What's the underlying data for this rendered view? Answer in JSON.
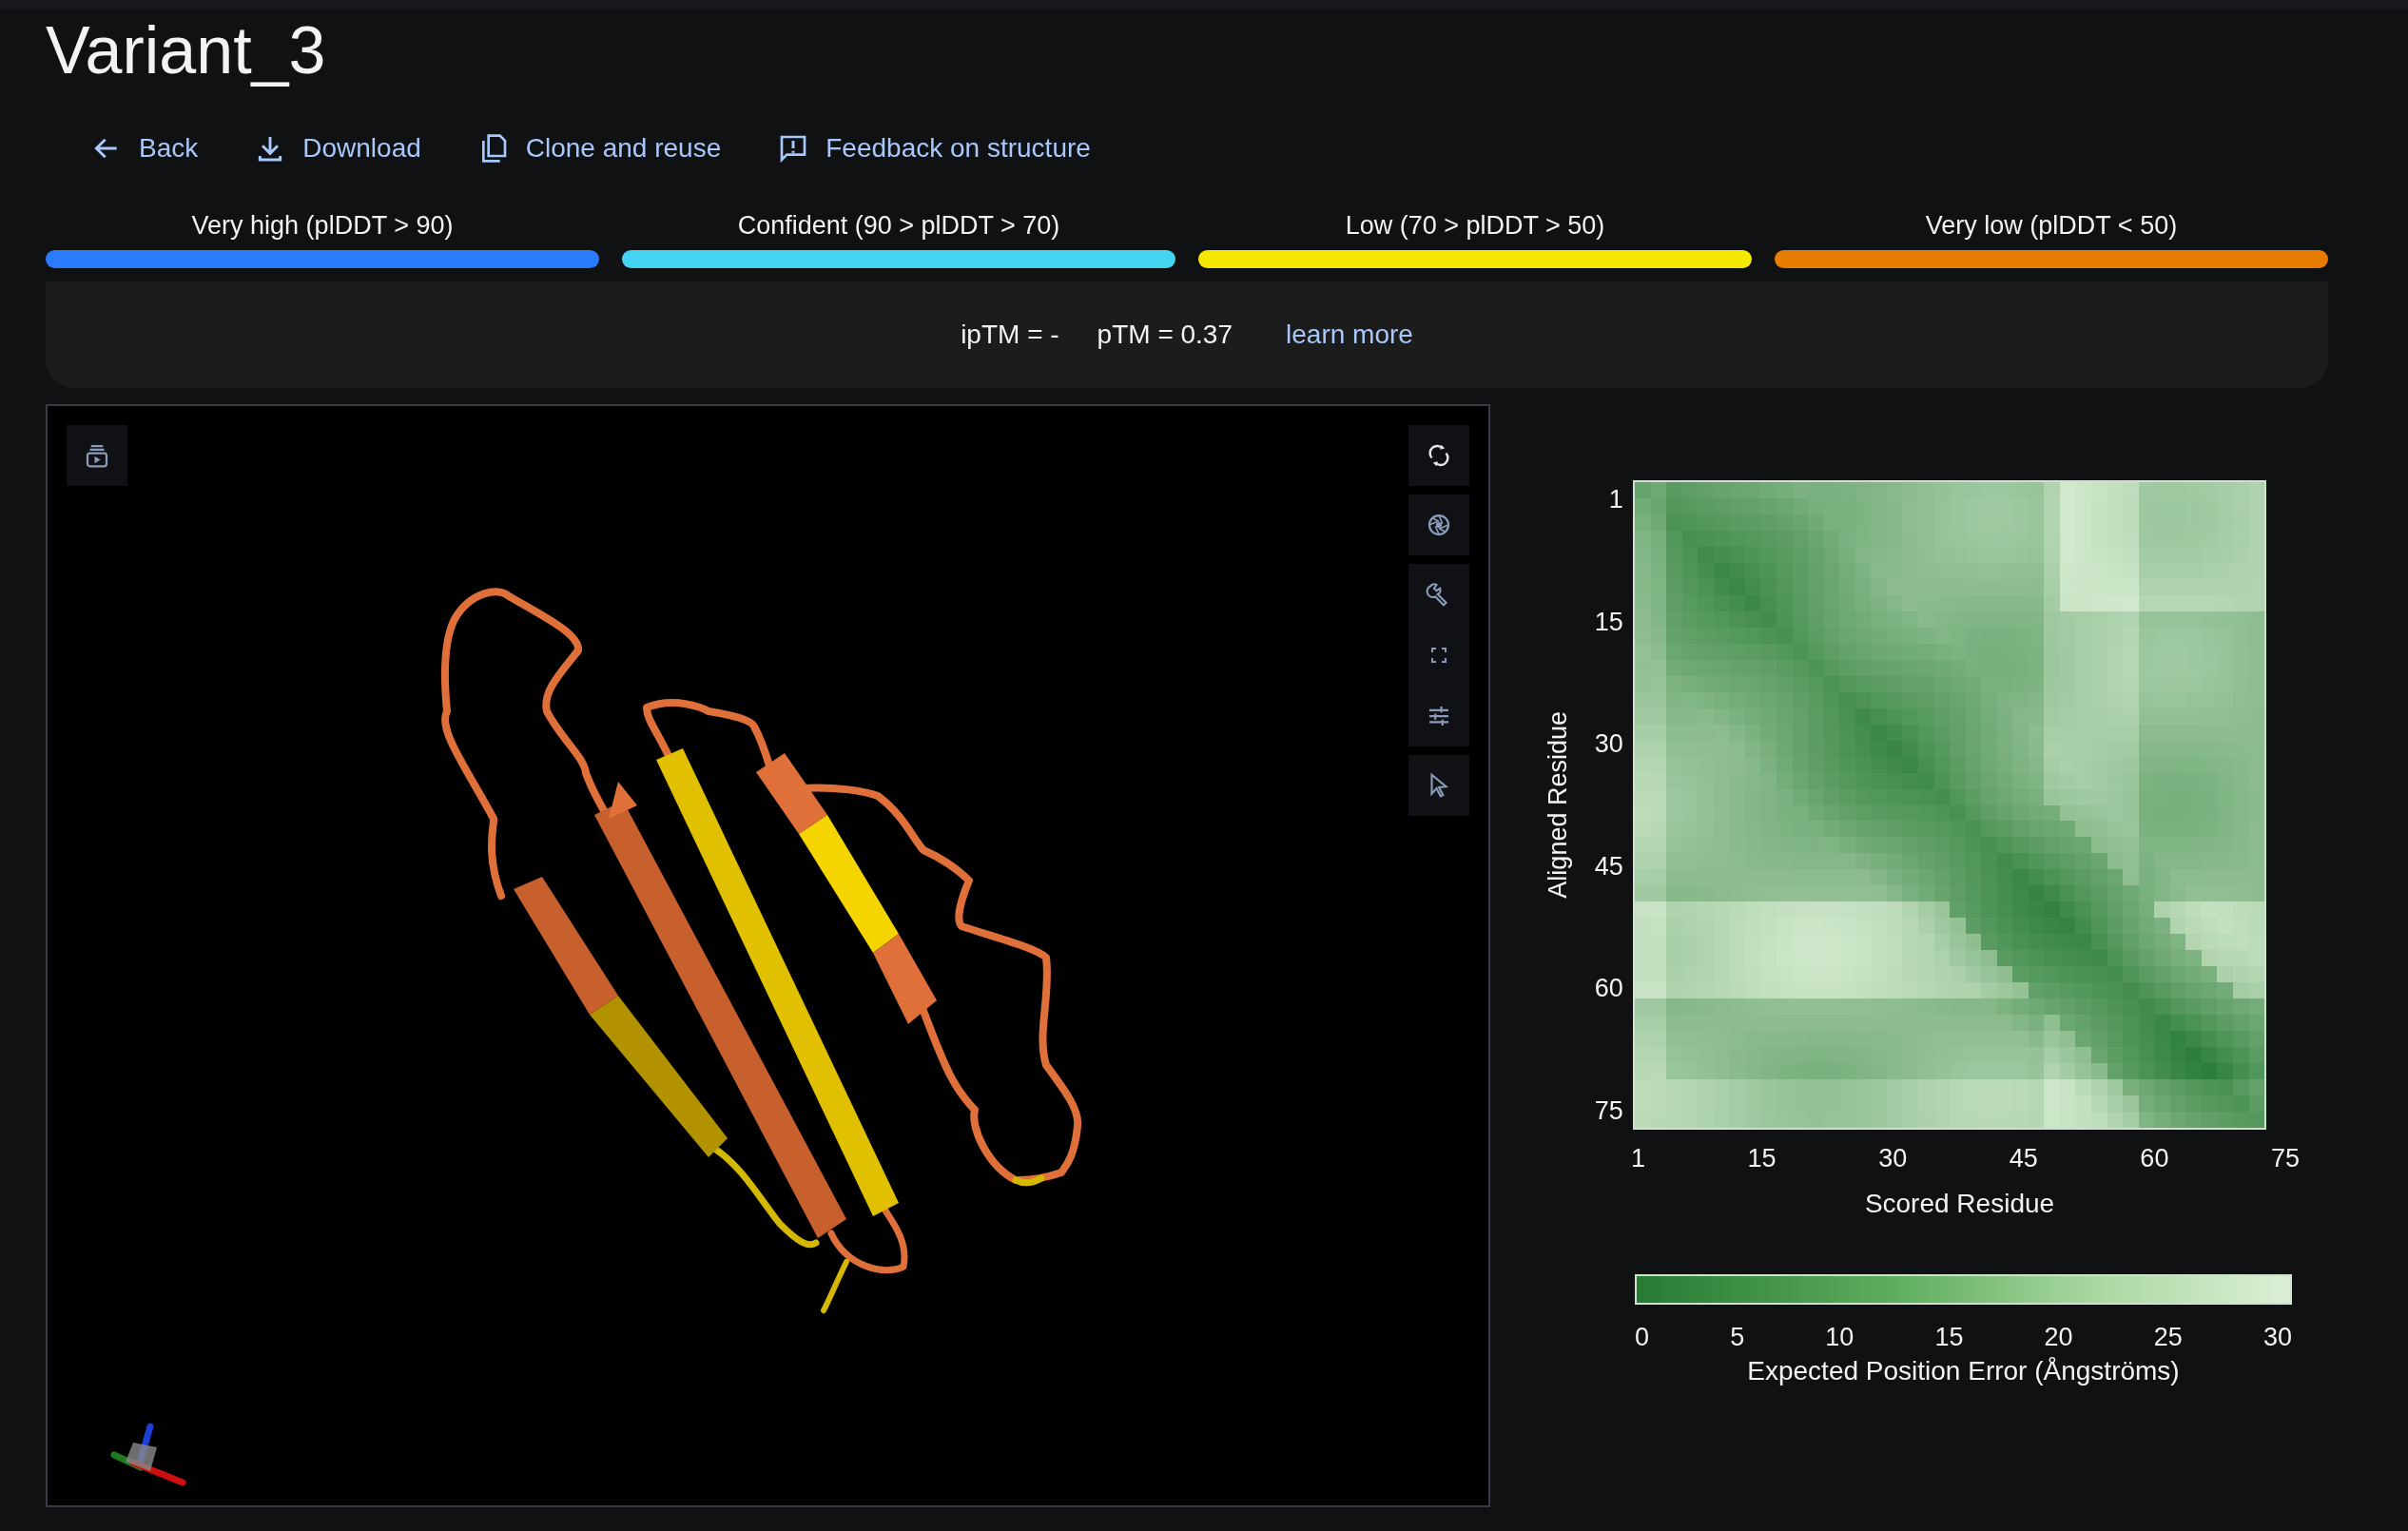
{
  "title": "Variant_3",
  "actions": [
    {
      "label": "Back",
      "kind": "back"
    },
    {
      "label": "Download",
      "kind": "download"
    },
    {
      "label": "Clone and reuse",
      "kind": "clone"
    },
    {
      "label": "Feedback on structure",
      "kind": "feedback"
    }
  ],
  "confidence_legend": [
    {
      "label": "Very high (plDDT > 90)",
      "color": "#2a7bff"
    },
    {
      "label": "Confident (90 > plDDT > 70)",
      "color": "#45d3f2"
    },
    {
      "label": "Low (70 > plDDT > 50)",
      "color": "#f5e800"
    },
    {
      "label": "Very low (plDDT < 50)",
      "color": "#e67c00"
    }
  ],
  "scores": {
    "iptm": "ipTM = -",
    "ptm": "pTM = 0.37",
    "link": "learn more"
  },
  "viewer": {
    "top_tools": [
      {
        "kind": "play"
      }
    ],
    "side_tools": [
      {
        "kind": "rotate"
      },
      {
        "kind": "snapshot"
      },
      {
        "kind": "wrench"
      },
      {
        "kind": "expand"
      },
      {
        "kind": "sliders"
      },
      {
        "kind": "pointer"
      }
    ]
  },
  "pae_plot": {
    "y_ticks": [
      "1",
      "15",
      "30",
      "45",
      "60",
      "75"
    ],
    "x_ticks": [
      "1",
      "15",
      "30",
      "45",
      "60",
      "75"
    ],
    "xlabel": "Scored Residue",
    "ylabel": "Aligned Residue",
    "scale_ticks": [
      "0",
      "5",
      "10",
      "15",
      "20",
      "25",
      "30"
    ],
    "scale_label": "Expected Position Error (Ångströms)"
  }
}
